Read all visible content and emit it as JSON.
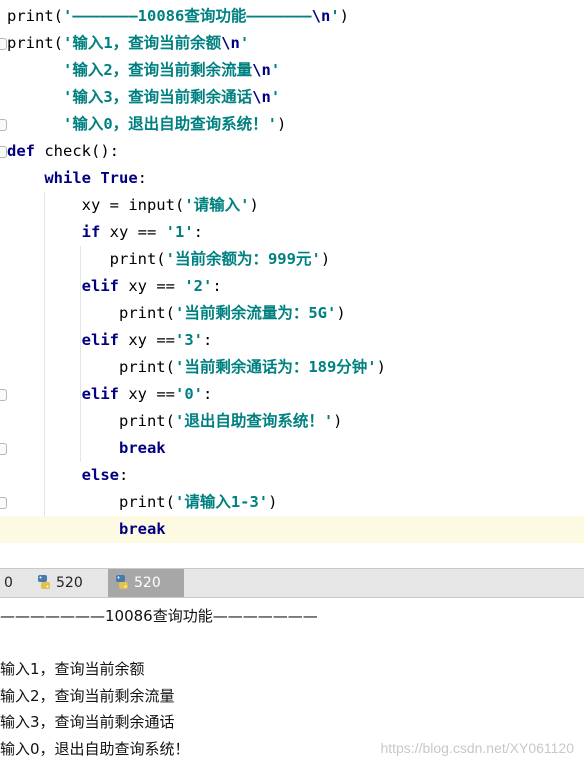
{
  "editor": {
    "lines": [
      {
        "segs": [
          {
            "c": "p",
            "t": "print("
          },
          {
            "c": "s",
            "t": "'———————10086查询功能———————"
          },
          {
            "c": "esc",
            "t": "\\n"
          },
          {
            "c": "s",
            "t": "'"
          },
          {
            "c": "p",
            "t": ")"
          }
        ]
      },
      {
        "segs": [
          {
            "c": "p",
            "t": "print("
          },
          {
            "c": "s",
            "t": "'输入1，查询当前余额"
          },
          {
            "c": "esc",
            "t": "\\n"
          },
          {
            "c": "s",
            "t": "'"
          }
        ]
      },
      {
        "segs": [
          {
            "c": "s",
            "t": "      '输入2，查询当前剩余流量"
          },
          {
            "c": "esc",
            "t": "\\n"
          },
          {
            "c": "s",
            "t": "'"
          }
        ]
      },
      {
        "segs": [
          {
            "c": "s",
            "t": "      '输入3，查询当前剩余通话"
          },
          {
            "c": "esc",
            "t": "\\n"
          },
          {
            "c": "s",
            "t": "'"
          }
        ]
      },
      {
        "segs": [
          {
            "c": "s",
            "t": "      '输入0，退出自助查询系统！'"
          },
          {
            "c": "p",
            "t": ")"
          }
        ]
      },
      {
        "segs": [
          {
            "c": "k",
            "t": "def "
          },
          {
            "c": "p",
            "t": "check():"
          }
        ]
      },
      {
        "segs": [
          {
            "c": "k",
            "t": "    while True"
          },
          {
            "c": "p",
            "t": ":"
          }
        ]
      },
      {
        "segs": [
          {
            "c": "p",
            "t": "        xy = input("
          },
          {
            "c": "s",
            "t": "'请输入'"
          },
          {
            "c": "p",
            "t": ")"
          }
        ]
      },
      {
        "segs": [
          {
            "c": "k",
            "t": "        if "
          },
          {
            "c": "p",
            "t": "xy == "
          },
          {
            "c": "s",
            "t": "'1'"
          },
          {
            "c": "p",
            "t": ":"
          }
        ]
      },
      {
        "segs": [
          {
            "c": "p",
            "t": "           print("
          },
          {
            "c": "s",
            "t": "'当前余额为：999元'"
          },
          {
            "c": "p",
            "t": ")"
          }
        ]
      },
      {
        "segs": [
          {
            "c": "k",
            "t": "        elif "
          },
          {
            "c": "p",
            "t": "xy == "
          },
          {
            "c": "s",
            "t": "'2'"
          },
          {
            "c": "p",
            "t": ":"
          }
        ]
      },
      {
        "segs": [
          {
            "c": "p",
            "t": "            print("
          },
          {
            "c": "s",
            "t": "'当前剩余流量为：5G'"
          },
          {
            "c": "p",
            "t": ")"
          }
        ]
      },
      {
        "segs": [
          {
            "c": "k",
            "t": "        elif "
          },
          {
            "c": "p",
            "t": "xy =="
          },
          {
            "c": "s",
            "t": "'3'"
          },
          {
            "c": "p",
            "t": ":"
          }
        ]
      },
      {
        "segs": [
          {
            "c": "p",
            "t": "            print("
          },
          {
            "c": "s",
            "t": "'当前剩余通话为：189分钟'"
          },
          {
            "c": "p",
            "t": ")"
          }
        ]
      },
      {
        "segs": [
          {
            "c": "k",
            "t": "        elif "
          },
          {
            "c": "p",
            "t": "xy =="
          },
          {
            "c": "s",
            "t": "'0'"
          },
          {
            "c": "p",
            "t": ":"
          }
        ]
      },
      {
        "segs": [
          {
            "c": "p",
            "t": "            print("
          },
          {
            "c": "s",
            "t": "'退出自助查询系统！'"
          },
          {
            "c": "p",
            "t": ")"
          }
        ]
      },
      {
        "segs": [
          {
            "c": "k",
            "t": "            break"
          }
        ]
      },
      {
        "segs": [
          {
            "c": "k",
            "t": "        else"
          },
          {
            "c": "p",
            "t": ":"
          }
        ]
      },
      {
        "segs": [
          {
            "c": "p",
            "t": "            print("
          },
          {
            "c": "s",
            "t": "'请输入1-3'"
          },
          {
            "c": "p",
            "t": ")"
          }
        ]
      },
      {
        "segs": [
          {
            "c": "k",
            "t": "            break"
          }
        ],
        "current": true
      }
    ]
  },
  "tabs": {
    "left_fragment": "0",
    "items": [
      {
        "label": "520",
        "active": false
      },
      {
        "label": "520",
        "active": true
      }
    ]
  },
  "console": {
    "lines": [
      "———————10086查询功能———————",
      "",
      "输入1，查询当前余额",
      "输入2，查询当前剩余流量",
      "输入3，查询当前剩余通话",
      "输入0，退出自助查询系统！"
    ]
  },
  "watermark": "https://blog.csdn.net/XY061120",
  "colors": {
    "keyword": "#000080",
    "string": "#008080",
    "current_line": "#fcfae3",
    "active_tab": "#a7a7a7"
  }
}
